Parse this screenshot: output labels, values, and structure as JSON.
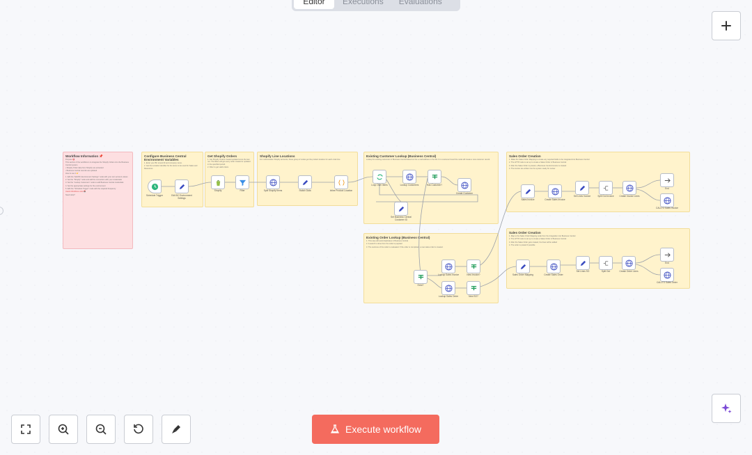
{
  "tabs": [
    "Editor",
    "Executions",
    "Evaluations"
  ],
  "execute_label": "Execute workflow",
  "colors": {
    "accent": "#f46b5e",
    "sticky": "#fff3cc",
    "sticky_pink": "#fddfe1"
  },
  "icons": {
    "zoom_in": "plus-icon",
    "fit": "fit-view-icon",
    "zoom_in_ctrl": "zoom-in-icon",
    "zoom_out": "zoom-out-icon",
    "reset": "reset-zoom-icon",
    "tidy": "tidy-up-icon",
    "ai": "sparkle-icon",
    "flask": "flask-icon"
  },
  "stickies": [
    {
      "title": "Workflow Information 📌",
      "lines": [
        "Purpose 🎯",
        "This section of the workflow is to integrate the Shopify Orders into the Business Central system.",
        "• Shopify Order data from Shopify are extracted",
        "• Business Central records are updated",
        "How to use it 👉",
        "1. Edit the \"Edit BC Environment Settings\" node with your own account values",
        "2. Set the \"Shopify\" node and add the connection with your credentials",
        "3. Set the \"Lookup Customers\" node to add Business Central credentials",
        "4. Set the appropriate settings for the environment",
        "5. Edit the \"Schedule Trigger\" node with the required frequency",
        "Useful Workflow Links 📚",
        "Need Help?"
      ]
    },
    {
      "title": "Configure Business Central Environment Variables",
      "lines": [
        "1. Enter your BC tenant ID and company name.",
        "2. Get the Location identifier for the items to be used for Sales and Resources"
      ]
    },
    {
      "title": "Get Shopify Orders",
      "lines": [
        "1. Get Shopify Orders created updated since the last run. The filters will get every order created or updated in the specified period.",
        "2. Filter to get valid orders"
      ]
    },
    {
      "title": "Shopify Line Locations",
      "lines": [
        "For multi-location Shopify accounts, these group of nodes get the product location for each order line"
      ]
    },
    {
      "title": "Existing Customer Lookup (Business Central)",
      "lines": [
        "Lookup for existing customers in Business Central based on the e-mail address in the bill. If no customer found the node will create a new customer record."
      ]
    },
    {
      "title": "Existing Order Lookup (Business Central)",
      "lines": [
        "1. This step will avoid duplicates in Business Central",
        "2. A search is done from the order to payload",
        "3. The outcome of the order is evaluated. If the order is completed, a new sales order is created."
      ]
    },
    {
      "title": "Sales Order Creation",
      "lines": [
        "1. Make the Sales Order Mapping to create any required fields to be integrated into Business Central",
        "2. The HTTP node is set up to create a Sales Order in Business Central",
        "3. After the Sales Order is posted, a Business Central invoice is created",
        "4. The invoice are written into the system ready for review"
      ]
    },
    {
      "title": "Sales Order Creation",
      "lines": [
        "1. Map to the Sales Order Mapping node from the Integration into Business Central",
        "2. The HTTP node is set up to create a Sales Order in Business Central",
        "3. After the Sales Order gets created, the lines will be added",
        "4. The order is posted if possible"
      ]
    }
  ],
  "nodes": [
    {
      "label": "Schedule Trigger",
      "icon": "clock-icon"
    },
    {
      "label": "Edit BC Environment Settings",
      "icon": "pencil-icon"
    },
    {
      "label": "Shopify",
      "icon": "shopify-icon"
    },
    {
      "label": "Filter",
      "icon": "filter-icon"
    },
    {
      "label": "Split Shopify Items",
      "icon": "globe-icon"
    },
    {
      "label": "Switch Data",
      "icon": "pencil-icon"
    },
    {
      "label": "Inline Product Location",
      "icon": "code-icon"
    },
    {
      "label": "Loop Over Items",
      "icon": "loop-icon"
    },
    {
      "label": "Lookup Customers",
      "icon": "globe-icon"
    },
    {
      "label": "Has Customer?",
      "icon": "if-icon"
    },
    {
      "label": "Create Customer",
      "icon": "globe-icon"
    },
    {
      "label": "Set Business Central Customer ID",
      "icon": "pencil-icon"
    },
    {
      "label": "Exist?",
      "icon": "if-icon"
    },
    {
      "label": "Lookup Sales Invoice",
      "icon": "globe-icon"
    },
    {
      "label": "New Invoice?",
      "icon": "if-icon"
    },
    {
      "label": "Lookup Sales Order",
      "icon": "globe-icon"
    },
    {
      "label": "New SO?",
      "icon": "if-icon"
    },
    {
      "label": "Sales Invoice",
      "icon": "pencil-icon"
    },
    {
      "label": "Create Sales Invoice",
      "icon": "globe-icon"
    },
    {
      "label": "Set Lines Invoice",
      "icon": "pencil-icon"
    },
    {
      "label": "Split Out Invoice",
      "icon": "split-icon"
    },
    {
      "label": "Create Invoice Lines",
      "icon": "globe-icon"
    },
    {
      "label": "End",
      "icon": "arrow-icon"
    },
    {
      "label": "CALLTO Sales Invoice",
      "icon": "globe-icon"
    },
    {
      "label": "Sales Order Mapping",
      "icon": "pencil-icon"
    },
    {
      "label": "Create Sales Order",
      "icon": "globe-icon"
    },
    {
      "label": "Set Lines SO",
      "icon": "pencil-icon"
    },
    {
      "label": "Split Out",
      "icon": "split-icon"
    },
    {
      "label": "Create Order Lines",
      "icon": "globe-icon"
    },
    {
      "label": "End",
      "icon": "arrow-icon"
    },
    {
      "label": "CALLTO Sales Order",
      "icon": "globe-icon"
    }
  ]
}
